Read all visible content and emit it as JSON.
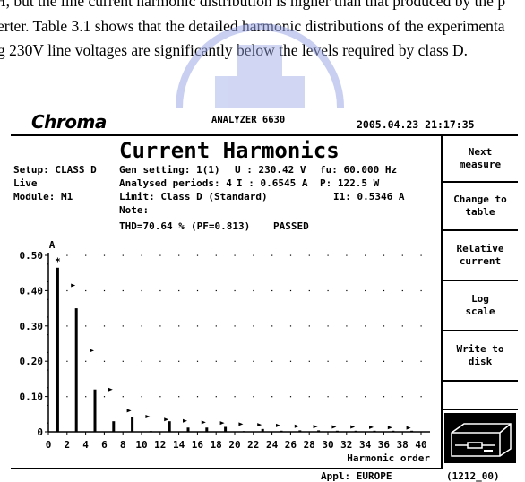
{
  "paper_text": {
    "lines": [
      "H, but the line current harmonic distribution is higher than that produced by the p",
      "erter. Table 3.1 shows that the detailed harmonic distributions of the experimenta",
      "g 230V line voltages are significantly below the levels required by class D."
    ]
  },
  "watermark": {
    "color": "#9aa8e6"
  },
  "analyzer": {
    "logo": "Chroma",
    "model": "ANALYZER 6630",
    "datetime": "2005.04.23 21:17:35",
    "title": "Current Harmonics",
    "info": {
      "setup": "Setup: CLASS D",
      "mode": "Live",
      "module": "Module: M1",
      "gen_setting": "Gen setting: 1(1)",
      "analysed_periods": "Analysed periods: 4",
      "limit": "Limit: Class D (Standard)",
      "note": "Note:",
      "voltage": "U : 230.42 V",
      "current": "I : 0.6545 A",
      "fu": "fu: 60.000 Hz",
      "power": "P: 122.5 W",
      "i1": "I1: 0.5346 A",
      "thd": "THD=70.64 %",
      "pf": "(PF=0.813)",
      "result": "PASSED"
    },
    "buttons": [
      {
        "line1": "Next",
        "line2": "measure"
      },
      {
        "line1": "Change to",
        "line2": "table"
      },
      {
        "line1": "Relative",
        "line2": "current"
      },
      {
        "line1": "Log",
        "line2": "scale"
      },
      {
        "line1": "Write to",
        "line2": "disk"
      }
    ],
    "disk_icon": "floppy-drive-icon",
    "appl": "Appl: EUROPE",
    "version": "(1212_00)"
  },
  "chart_data": {
    "type": "bar",
    "title": "",
    "ylabel": "A",
    "xlabel": "Harmonic order",
    "xlim": [
      0,
      40
    ],
    "ylim": [
      0,
      0.5
    ],
    "xticks": [
      "0",
      "2",
      "4",
      "6",
      "8",
      "10",
      "12",
      "14",
      "16",
      "18",
      "20",
      "22",
      "24",
      "26",
      "28",
      "30",
      "32",
      "34",
      "36",
      "38",
      "40"
    ],
    "yticks": [
      "0",
      "0.10",
      "0.20",
      "0.30",
      "0.40",
      "0.50"
    ],
    "grid": "dotted",
    "series": [
      {
        "marker": "bar",
        "x": [
          1,
          3,
          5,
          7,
          9,
          11,
          13,
          15,
          17,
          19,
          21,
          23,
          25,
          27,
          29,
          31,
          33,
          35,
          37,
          39
        ],
        "values": [
          0.465,
          0.35,
          0.12,
          0.03,
          0.043,
          0.002,
          0.03,
          0.012,
          0.012,
          0.014,
          0.002,
          0.008,
          0.003,
          0.004,
          0.004,
          0.003,
          0.003,
          0.003,
          0.003,
          0.003
        ]
      },
      {
        "marker": "triangle-limit",
        "x": [
          3,
          5,
          7,
          9,
          11,
          13,
          15,
          17,
          19,
          21,
          23,
          25,
          27,
          29,
          31,
          33,
          35,
          37,
          39
        ],
        "values": [
          0.415,
          0.23,
          0.12,
          0.06,
          0.043,
          0.035,
          0.031,
          0.027,
          0.025,
          0.022,
          0.02,
          0.018,
          0.016,
          0.015,
          0.014,
          0.014,
          0.013,
          0.012,
          0.011
        ]
      },
      {
        "marker": "star",
        "x": [
          1
        ],
        "values": [
          0.483
        ]
      }
    ]
  }
}
